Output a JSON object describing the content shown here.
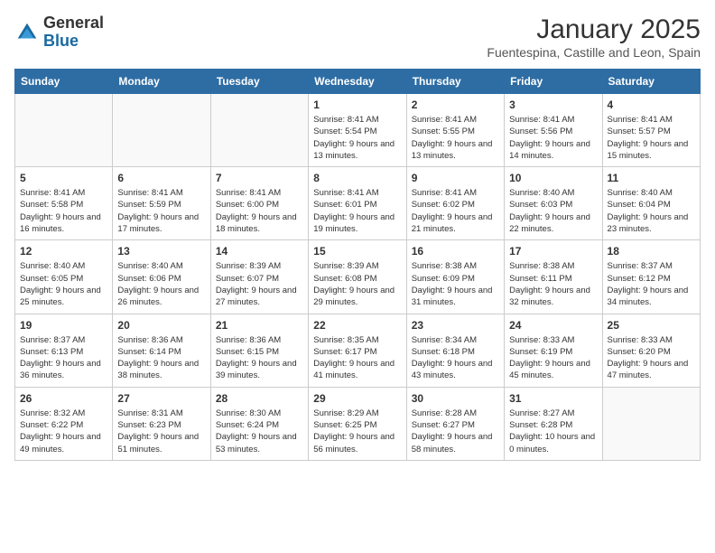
{
  "logo": {
    "general": "General",
    "blue": "Blue"
  },
  "title": "January 2025",
  "subtitle": "Fuentespina, Castille and Leon, Spain",
  "days": [
    "Sunday",
    "Monday",
    "Tuesday",
    "Wednesday",
    "Thursday",
    "Friday",
    "Saturday"
  ],
  "weeks": [
    [
      {
        "num": "",
        "text": ""
      },
      {
        "num": "",
        "text": ""
      },
      {
        "num": "",
        "text": ""
      },
      {
        "num": "1",
        "text": "Sunrise: 8:41 AM\nSunset: 5:54 PM\nDaylight: 9 hours and 13 minutes."
      },
      {
        "num": "2",
        "text": "Sunrise: 8:41 AM\nSunset: 5:55 PM\nDaylight: 9 hours and 13 minutes."
      },
      {
        "num": "3",
        "text": "Sunrise: 8:41 AM\nSunset: 5:56 PM\nDaylight: 9 hours and 14 minutes."
      },
      {
        "num": "4",
        "text": "Sunrise: 8:41 AM\nSunset: 5:57 PM\nDaylight: 9 hours and 15 minutes."
      }
    ],
    [
      {
        "num": "5",
        "text": "Sunrise: 8:41 AM\nSunset: 5:58 PM\nDaylight: 9 hours and 16 minutes."
      },
      {
        "num": "6",
        "text": "Sunrise: 8:41 AM\nSunset: 5:59 PM\nDaylight: 9 hours and 17 minutes."
      },
      {
        "num": "7",
        "text": "Sunrise: 8:41 AM\nSunset: 6:00 PM\nDaylight: 9 hours and 18 minutes."
      },
      {
        "num": "8",
        "text": "Sunrise: 8:41 AM\nSunset: 6:01 PM\nDaylight: 9 hours and 19 minutes."
      },
      {
        "num": "9",
        "text": "Sunrise: 8:41 AM\nSunset: 6:02 PM\nDaylight: 9 hours and 21 minutes."
      },
      {
        "num": "10",
        "text": "Sunrise: 8:40 AM\nSunset: 6:03 PM\nDaylight: 9 hours and 22 minutes."
      },
      {
        "num": "11",
        "text": "Sunrise: 8:40 AM\nSunset: 6:04 PM\nDaylight: 9 hours and 23 minutes."
      }
    ],
    [
      {
        "num": "12",
        "text": "Sunrise: 8:40 AM\nSunset: 6:05 PM\nDaylight: 9 hours and 25 minutes."
      },
      {
        "num": "13",
        "text": "Sunrise: 8:40 AM\nSunset: 6:06 PM\nDaylight: 9 hours and 26 minutes."
      },
      {
        "num": "14",
        "text": "Sunrise: 8:39 AM\nSunset: 6:07 PM\nDaylight: 9 hours and 27 minutes."
      },
      {
        "num": "15",
        "text": "Sunrise: 8:39 AM\nSunset: 6:08 PM\nDaylight: 9 hours and 29 minutes."
      },
      {
        "num": "16",
        "text": "Sunrise: 8:38 AM\nSunset: 6:09 PM\nDaylight: 9 hours and 31 minutes."
      },
      {
        "num": "17",
        "text": "Sunrise: 8:38 AM\nSunset: 6:11 PM\nDaylight: 9 hours and 32 minutes."
      },
      {
        "num": "18",
        "text": "Sunrise: 8:37 AM\nSunset: 6:12 PM\nDaylight: 9 hours and 34 minutes."
      }
    ],
    [
      {
        "num": "19",
        "text": "Sunrise: 8:37 AM\nSunset: 6:13 PM\nDaylight: 9 hours and 36 minutes."
      },
      {
        "num": "20",
        "text": "Sunrise: 8:36 AM\nSunset: 6:14 PM\nDaylight: 9 hours and 38 minutes."
      },
      {
        "num": "21",
        "text": "Sunrise: 8:36 AM\nSunset: 6:15 PM\nDaylight: 9 hours and 39 minutes."
      },
      {
        "num": "22",
        "text": "Sunrise: 8:35 AM\nSunset: 6:17 PM\nDaylight: 9 hours and 41 minutes."
      },
      {
        "num": "23",
        "text": "Sunrise: 8:34 AM\nSunset: 6:18 PM\nDaylight: 9 hours and 43 minutes."
      },
      {
        "num": "24",
        "text": "Sunrise: 8:33 AM\nSunset: 6:19 PM\nDaylight: 9 hours and 45 minutes."
      },
      {
        "num": "25",
        "text": "Sunrise: 8:33 AM\nSunset: 6:20 PM\nDaylight: 9 hours and 47 minutes."
      }
    ],
    [
      {
        "num": "26",
        "text": "Sunrise: 8:32 AM\nSunset: 6:22 PM\nDaylight: 9 hours and 49 minutes."
      },
      {
        "num": "27",
        "text": "Sunrise: 8:31 AM\nSunset: 6:23 PM\nDaylight: 9 hours and 51 minutes."
      },
      {
        "num": "28",
        "text": "Sunrise: 8:30 AM\nSunset: 6:24 PM\nDaylight: 9 hours and 53 minutes."
      },
      {
        "num": "29",
        "text": "Sunrise: 8:29 AM\nSunset: 6:25 PM\nDaylight: 9 hours and 56 minutes."
      },
      {
        "num": "30",
        "text": "Sunrise: 8:28 AM\nSunset: 6:27 PM\nDaylight: 9 hours and 58 minutes."
      },
      {
        "num": "31",
        "text": "Sunrise: 8:27 AM\nSunset: 6:28 PM\nDaylight: 10 hours and 0 minutes."
      },
      {
        "num": "",
        "text": ""
      }
    ]
  ]
}
